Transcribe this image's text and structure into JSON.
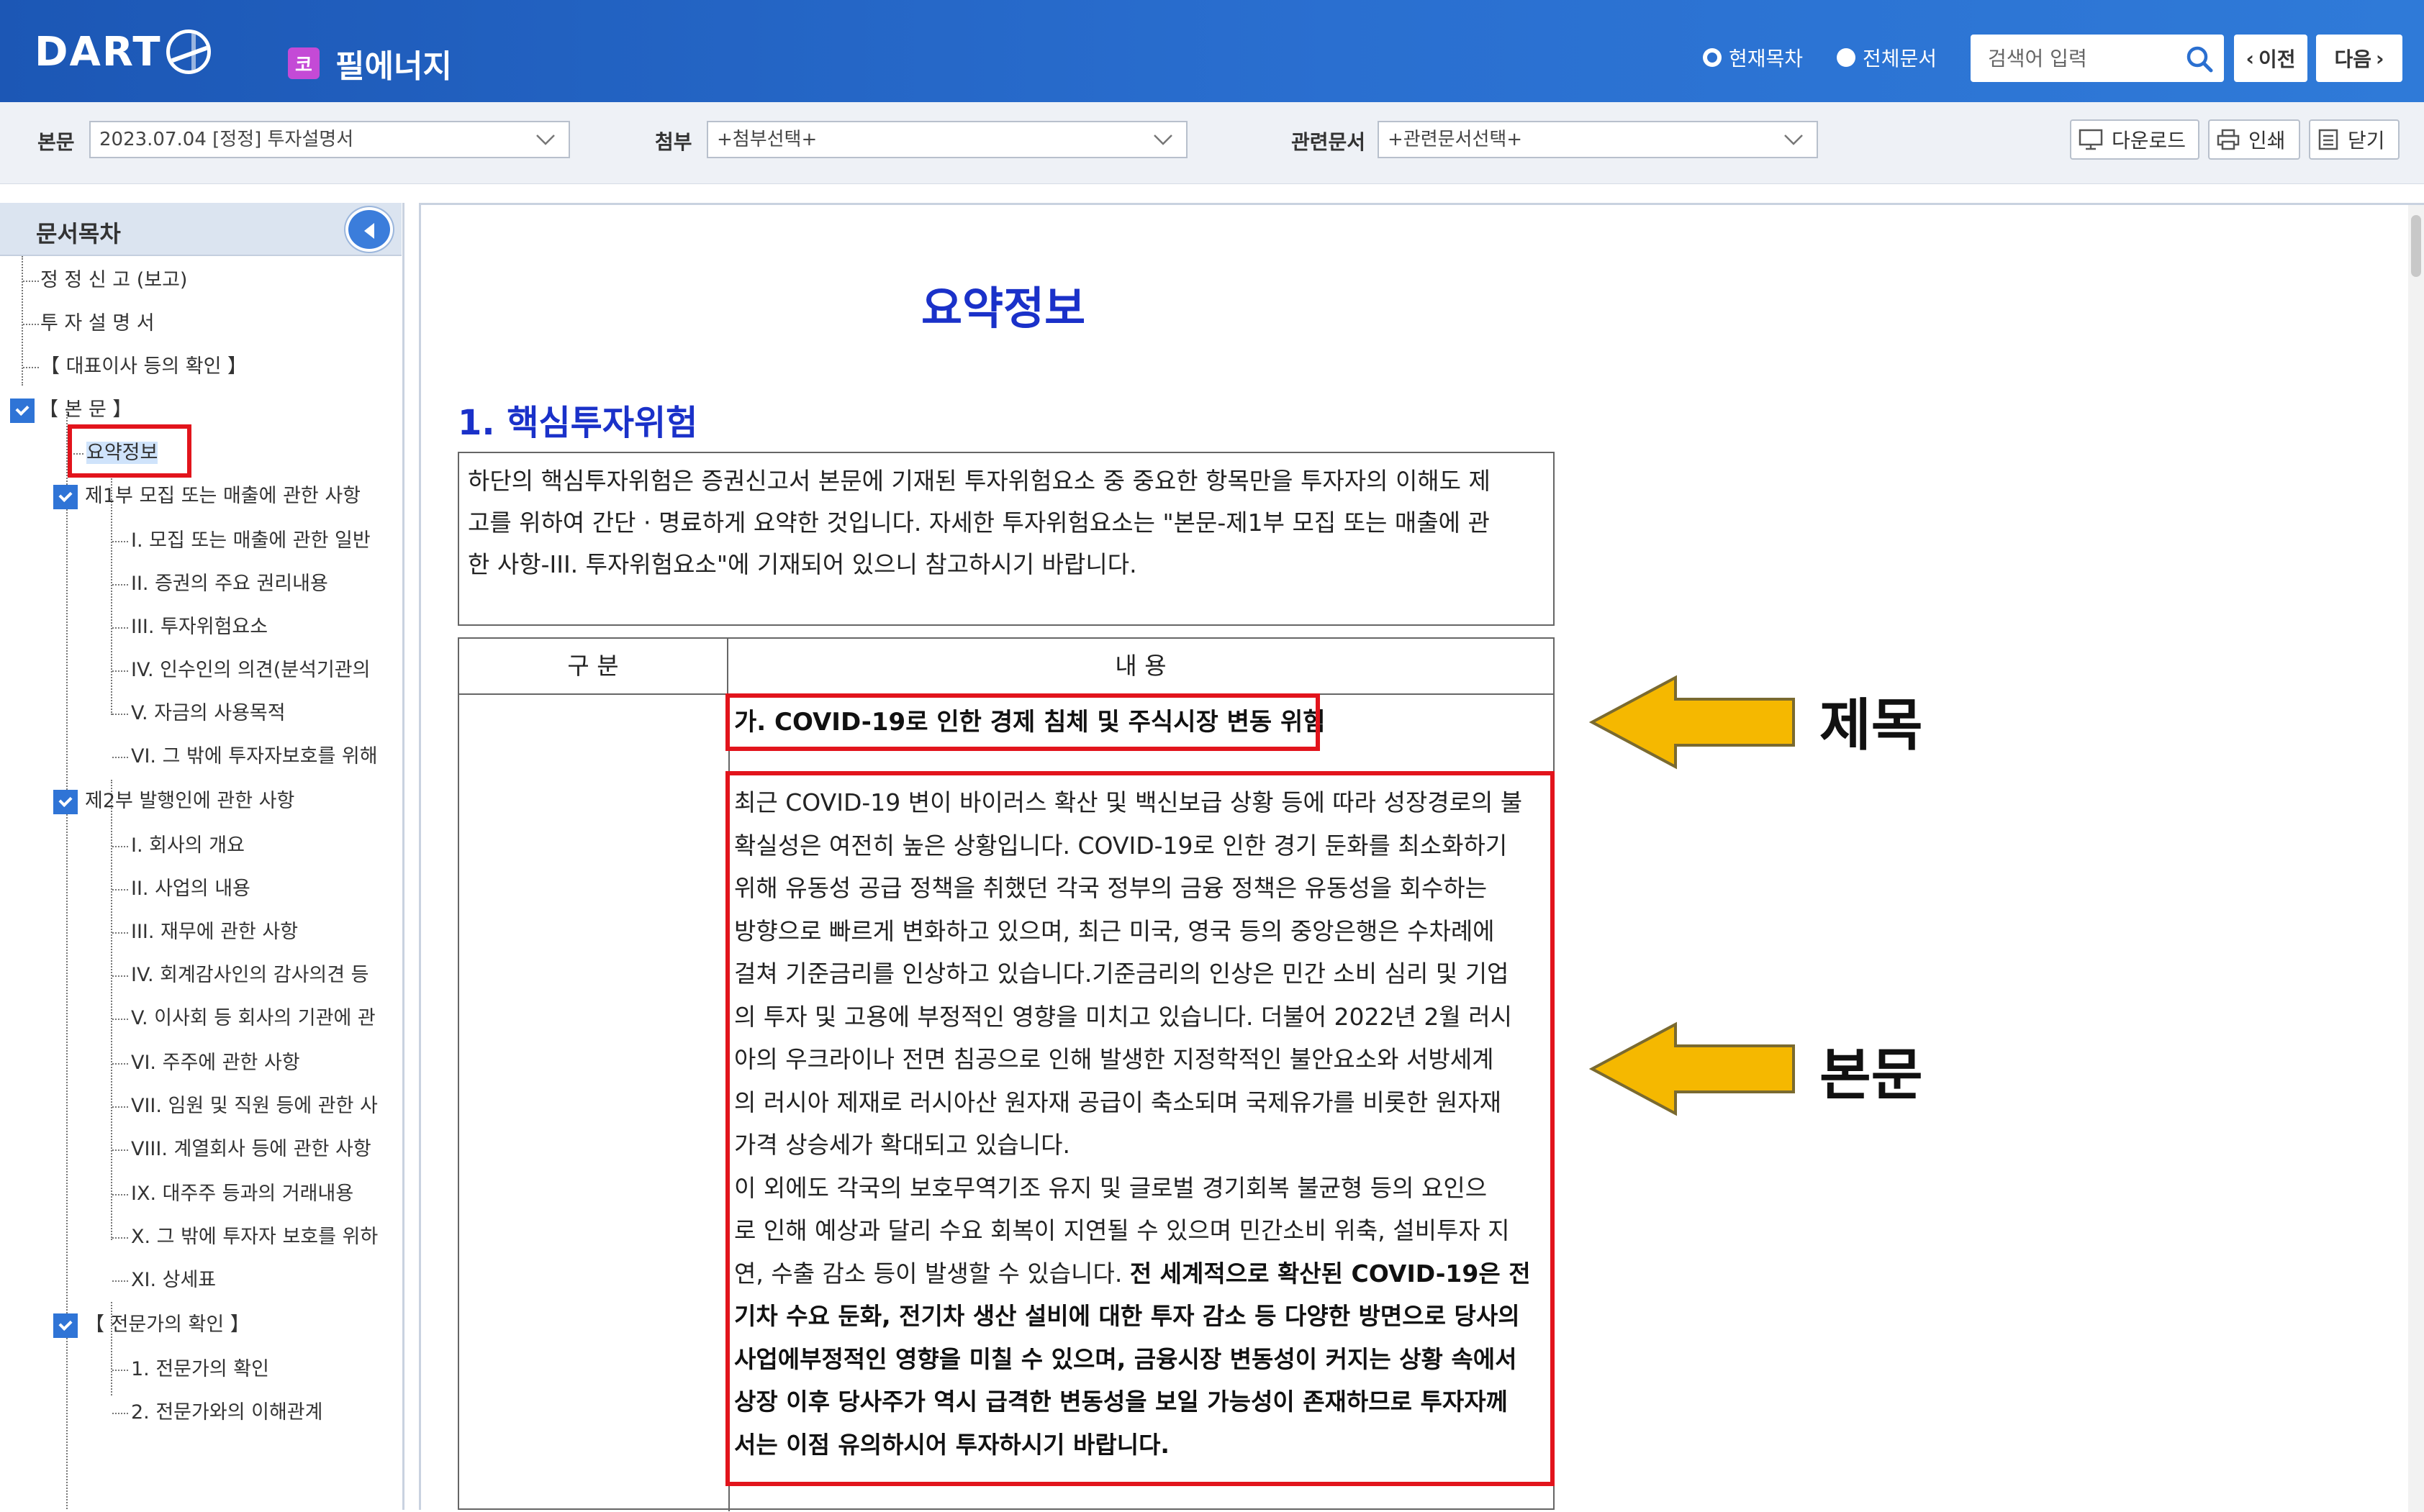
{
  "header": {
    "logo": "DART",
    "company_badge": "코",
    "company_name": "필에너지",
    "radio_current": "현재목차",
    "radio_all": "전체문서",
    "search_placeholder": "검색어 입력",
    "prev_label": "이전",
    "next_label": "다음"
  },
  "toolbar": {
    "main_label": "본문",
    "main_value": "2023.07.04 [정정] 투자설명서",
    "attach_label": "첨부",
    "attach_value": "+첨부선택+",
    "related_label": "관련문서",
    "related_value": "+관련문서선택+",
    "download_label": "다운로드",
    "print_label": "인쇄",
    "close_label": "닫기"
  },
  "sidebar": {
    "title": "문서목차",
    "items": [
      "정 정 신 고 (보고)",
      "투 자 설 명 서",
      "【 대표이사 등의 확인 】",
      "【 본 문 】",
      "요약정보",
      "제1부 모집 또는 매출에 관한 사항",
      "I. 모집 또는 매출에 관한 일반",
      "II. 증권의 주요 권리내용",
      "III. 투자위험요소",
      "IV. 인수인의 의견(분석기관의",
      "V. 자금의 사용목적",
      "VI. 그 밖에 투자자보호를 위해",
      "제2부 발행인에 관한 사항",
      "I. 회사의 개요",
      "II. 사업의 내용",
      "III. 재무에 관한 사항",
      "IV. 회계감사인의 감사의견 등",
      "V. 이사회 등 회사의 기관에 관",
      "VI. 주주에 관한 사항",
      "VII. 임원 및 직원 등에 관한 사",
      "VIII. 계열회사 등에 관한 사항",
      "IX. 대주주 등과의 거래내용",
      "X. 그 밖에 투자자 보호를 위하",
      "XI. 상세표",
      "【 전문가의 확인 】",
      "1. 전문가의 확인",
      "2. 전문가와의 이해관계"
    ]
  },
  "document": {
    "title": "요약정보",
    "section_title": "1. 핵심투자위험",
    "intro_lines": [
      "하단의 핵심투자위험은 증권신고서 본문에 기재된 투자위험요소 중 중요한 항목만을 투자자의 이해도 제",
      "고를 위하여 간단 · 명료하게 요약한 것입니다. 자세한 투자위험요소는 \"본문-제1부 모집 또는 매출에 관",
      "한 사항-III. 투자위험요소\"에 기재되어 있으니 참고하시기 바랍니다."
    ],
    "table_header_col1": "구 분",
    "table_header_col2": "내 용",
    "risk_title": "가. COVID-19로 인한 경제 침체 및 주식시장 변동 위험",
    "body_lines": [
      "최근 COVID-19 변이 바이러스 확산 및 백신보급 상황 등에 따라 성장경로의 불",
      "확실성은 여전히 높은 상황입니다. COVID-19로 인한 경기 둔화를 최소화하기",
      "위해 유동성 공급 정책을 취했던 각국 정부의 금융 정책은 유동성을 회수하는",
      "방향으로 빠르게 변화하고 있으며, 최근 미국, 영국 등의 중앙은행은 수차례에",
      "걸쳐 기준금리를 인상하고 있습니다.기준금리의 인상은 민간 소비 심리 및 기업",
      "의 투자 및 고용에 부정적인 영향을 미치고 있습니다. 더불어 2022년 2월 러시",
      "아의 우크라이나 전면 침공으로 인해 발생한 지정학적인 불안요소와 서방세계",
      "의 러시아 제재로 러시아산 원자재 공급이 축소되며 국제유가를 비롯한 원자재",
      "가격 상승세가 확대되고 있습니다.",
      "이 외에도 각국의 보호무역기조 유지 및 글로벌 경기회복 불균형 등의 요인으",
      "로 인해 예상과 달리 수요 회복이 지연될 수 있으며 민간소비 위축, 설비투자 지",
      "연, 수출 감소 등이 발생할 수 있습니다. "
    ],
    "body_bold_start": "전 세계적으로 확산된 COVID-19은 전",
    "body_bold_lines": [
      "기차 수요 둔화, 전기차 생산 설비에 대한 투자 감소 등 다양한 방면으로 당사의",
      "사업에부정적인 영향을 미칠 수 있으며, 금융시장 변동성이 커지는 상황 속에서",
      "상장 이후 당사주가 역시 급격한 변동성을 보일 가능성이 존재하므로 투자자께",
      "서는 이점 유의하시어 투자하시기 바랍니다."
    ]
  },
  "annotations": {
    "title_label": "제목",
    "body_label": "본문",
    "arrow_color": "#f5b800",
    "highlight_color": "#e2141c"
  }
}
